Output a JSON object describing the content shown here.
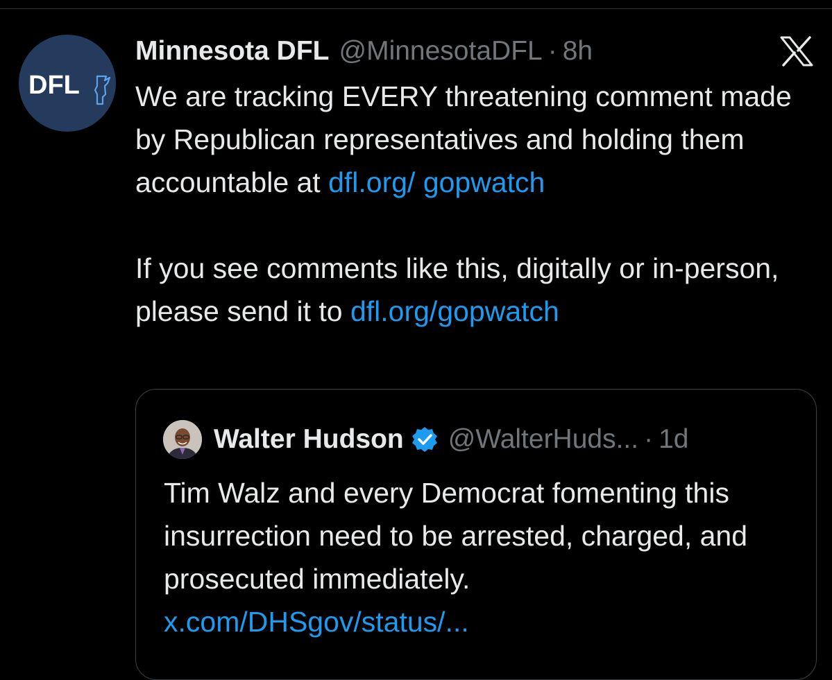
{
  "tweet": {
    "avatar_label": "DFL",
    "display_name": "Minnesota DFL",
    "handle": "@MinnesotaDFL",
    "separator": "·",
    "time": "8h",
    "body_part1": "We are tracking EVERY threatening comment made by Republican representatives and holding them accountable at ",
    "link1": "dfl.org/ gopwatch",
    "body_part2": "If you see comments like this, digitally or in-person, please send it to ",
    "link2": "dfl.org/gopwatch"
  },
  "quote": {
    "display_name": "Walter Hudson",
    "handle": "@WalterHuds...",
    "separator": "·",
    "time": "1d",
    "body": "Tim Walz and every Democrat fomenting this insurrection need to be arrested, charged, and prosecuted immediately.",
    "link": "x.com/DHSgov/status/..."
  },
  "icons": {
    "app_logo": "x-logo-icon",
    "verified": "verified-badge-icon"
  },
  "colors": {
    "background": "#000000",
    "text": "#e7e9ea",
    "muted": "#71767b",
    "link": "#1d9bf0",
    "avatar_bg": "#243b5e"
  }
}
